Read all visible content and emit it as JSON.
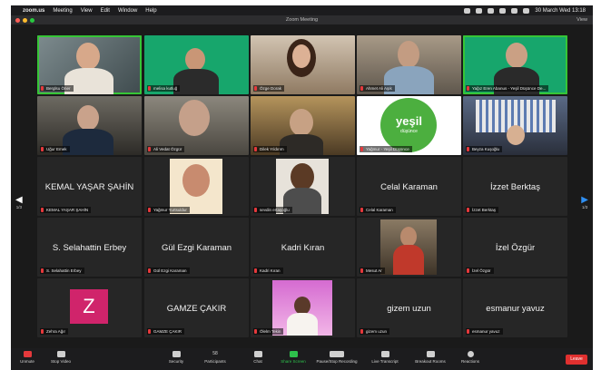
{
  "menubar": {
    "app": "zoom.us",
    "items": [
      "Meeting",
      "View",
      "Edit",
      "Window",
      "Help"
    ],
    "datetime": "30 March Wed 13:18"
  },
  "window": {
    "title": "Zoom Meeting",
    "view_label": "View"
  },
  "gallery": {
    "page_left": "1/3",
    "page_right": "1/3",
    "tiles": [
      {
        "name": "Berglsu Öner",
        "video": true,
        "speaking": true
      },
      {
        "name": "melisa kutluğ",
        "video": true
      },
      {
        "name": "Özge Dorak",
        "video": true
      },
      {
        "name": "Ahmet Ali Aşık",
        "video": true
      },
      {
        "name": "Yağız Eren Abanus - Yeşil Düşünce De...",
        "video": true,
        "speaking": true
      },
      {
        "name": "Uğur Emek",
        "video": true
      },
      {
        "name": "Ali Vedat Özgür",
        "video": true
      },
      {
        "name": "Dilek Yıldırım",
        "video": true
      },
      {
        "name": "Yağmur - Yeşil Düşünce",
        "video": true,
        "logo_text": "yeşil",
        "logo_sub": "düşünce"
      },
      {
        "name": "Beyza Kuşoğlu",
        "video": true
      },
      {
        "name": "KEMAL YAŞAR ŞAHİN",
        "center": "KEMAL YAŞAR ŞAHİN"
      },
      {
        "name": "Yağmur Yurtsuldur",
        "picture": true
      },
      {
        "name": "sevdin ertaşoğlu",
        "picture": true
      },
      {
        "name": "Celal Karaman",
        "center": "Celal Karaman"
      },
      {
        "name": "İzzet Berktaş",
        "center": "İzzet Berktaş"
      },
      {
        "name": "S. Selahattin Erbey",
        "center": "S. Selahattin Erbey"
      },
      {
        "name": "Gül Ezgi Karaman",
        "center": "Gül Ezgi Karaman"
      },
      {
        "name": "Kadri Kıran",
        "center": "Kadri Kıran"
      },
      {
        "name": "Mesut Ar",
        "picture": true
      },
      {
        "name": "İzel Özgür",
        "center": "İzel Özgür"
      },
      {
        "name": "Zehra Ağır",
        "avatar": "Z"
      },
      {
        "name": "GAMZE ÇAKIR",
        "center": "GAMZE ÇAKIR"
      },
      {
        "name": "Ölelm Tekin",
        "picture": true
      },
      {
        "name": "gizem uzun",
        "center": "gizem uzun"
      },
      {
        "name": "esmanur yavuz",
        "center": "esmanur yavuz"
      }
    ]
  },
  "toolbar": {
    "unmute": "Unmute",
    "stop_video": "Stop Video",
    "security": "Security",
    "participants": "Participants",
    "participants_count": "58",
    "chat": "Chat",
    "share_screen": "Share Screen",
    "pause_recording": "Pause/Stop Recording",
    "live_transcript": "Live Transcript",
    "breakout_rooms": "Breakout Rooms",
    "reactions": "Reactions",
    "leave": "Leave"
  },
  "colors": {
    "speaking_outline": "#36c536",
    "share_green": "#2ec14c",
    "leave_red": "#e0302f",
    "avatar_pink": "#d0246b"
  }
}
